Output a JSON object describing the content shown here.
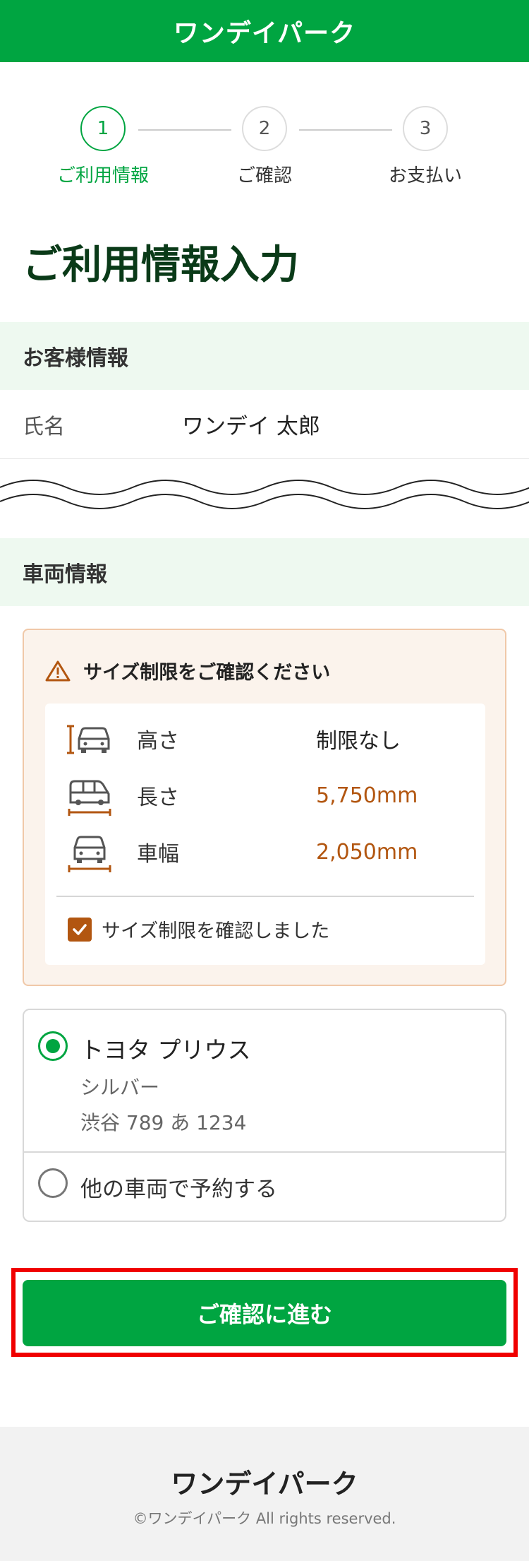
{
  "header": {
    "logo": "ワンデイパーク"
  },
  "steps": [
    {
      "number": "1",
      "label": "ご利用情報",
      "active": true
    },
    {
      "number": "2",
      "label": "ご確認",
      "active": false
    },
    {
      "number": "3",
      "label": "お支払い",
      "active": false
    }
  ],
  "page_title": "ご利用情報入力",
  "customer_section": {
    "title": "お客様情報",
    "name_label": "氏名",
    "name_value": "ワンデイ 太郎"
  },
  "vehicle_section": {
    "title": "車両情報",
    "size_notice": {
      "title": "サイズ制限をご確認ください",
      "rows": [
        {
          "icon": "car-height-icon",
          "label": "高さ",
          "value": "制限なし",
          "highlight": false
        },
        {
          "icon": "car-length-icon",
          "label": "長さ",
          "value": "5,750mm",
          "highlight": true
        },
        {
          "icon": "car-width-icon",
          "label": "車幅",
          "value": "2,050mm",
          "highlight": true
        }
      ],
      "confirm_label": "サイズ制限を確認しました",
      "confirm_checked": true
    },
    "vehicles": {
      "selected": {
        "name": "トヨタ プリウス",
        "color": "シルバー",
        "plate": "渋谷 789 あ 1234"
      },
      "other_label": "他の車両で予約する"
    }
  },
  "cta": {
    "label": "ご確認に進む"
  },
  "footer": {
    "logo": "ワンデイパーク",
    "copyright": "©ワンデイパーク All rights reserved."
  },
  "colors": {
    "brand_green": "#00a541",
    "warning_orange": "#b25610",
    "highlight_red": "#f00000"
  }
}
